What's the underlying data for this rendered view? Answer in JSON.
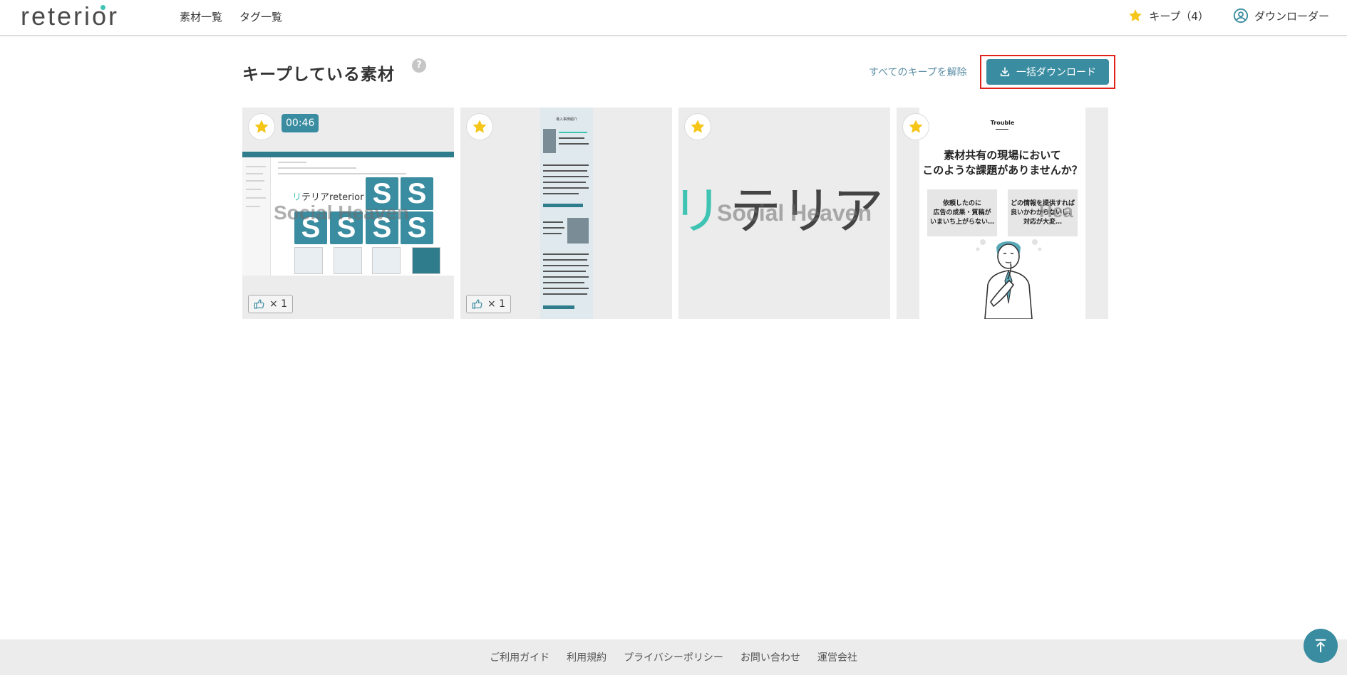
{
  "header": {
    "logo": "reterior",
    "nav": [
      "素材一覧",
      "タグ一覧"
    ],
    "keep_label": "キープ（4）",
    "download_user_label": "ダウンローダー"
  },
  "main": {
    "title": "キープしている素材",
    "help": "?",
    "unkeep_all_label": "すべてのキープを解除",
    "bulk_download_label": "一括ダウンロード"
  },
  "cards": [
    {
      "duration": "00:46",
      "like_count": "× 1",
      "watermark_jp": "リテリア",
      "watermark_en": "reterior",
      "watermark_brand": "Social Heaven",
      "tile_letter": "S"
    },
    {
      "like_count": "× 1",
      "doc_title": "導入事例紹介"
    },
    {
      "watermark_jp_1": "リ",
      "watermark_jp_2": "テリア",
      "watermark_brand": "Social Heaven"
    },
    {
      "tag": "Trouble",
      "headline_1": "素材共有の現場において",
      "headline_2": "このような課題がありませんか？",
      "box_1": [
        "依頼したのに",
        "広告の成果・質稿が",
        "いまいち上がらない…"
      ],
      "box_2": [
        "どの情報を提供すれば",
        "良いかわからないし、",
        "対応が大変…"
      ],
      "watermark_brand": "Hea"
    }
  ],
  "footer": {
    "links": [
      "ご利用ガイド",
      "利用規約",
      "プライバシーポリシー",
      "お問い合わせ",
      "運営会社"
    ]
  },
  "colors": {
    "accent": "#3a8ca0",
    "star": "#f5c518",
    "highlight_frame": "#e0241b",
    "logo_dot": "#3fc4b4"
  },
  "icons": {
    "star": "star-icon",
    "user": "user-circle-icon",
    "download": "download-icon",
    "thumbs_up": "thumbs-up-icon",
    "to_top": "arrow-to-top-icon",
    "help": "question-icon"
  }
}
